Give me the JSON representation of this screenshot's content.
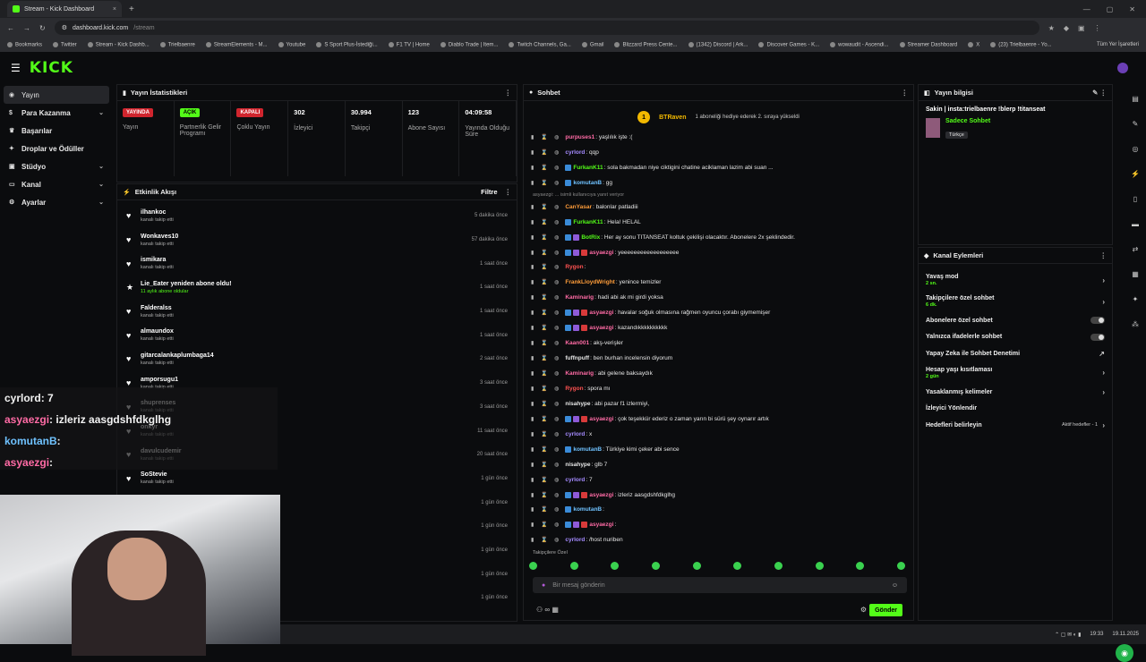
{
  "browser": {
    "tab_title": "Stream - Kick Dashboard",
    "url": "dashboard.kick.com",
    "url_path": "/stream",
    "new_tab": "+",
    "bookmarks": [
      "Bookmarks",
      "Twitter",
      "Stream - Kick Dashb...",
      "Trielbaenre",
      "StreamElements - M...",
      "Youtube",
      "S Sport Plus-İstediği...",
      "F1 TV | Home",
      "Diablo Trade | Item...",
      "Twitch Channels, Ga...",
      "Gmail",
      "Blizzard Press Cente...",
      "(1342) Discord | Ark...",
      "Discover Games - K...",
      "wowaudit - Ascendi...",
      "Streamer Dashboard",
      "X",
      "(23) Trielbaenre - Yo..."
    ],
    "all_bookmarks": "Tüm Yer İşaretleri"
  },
  "logo": "KICK",
  "sidebar": {
    "items": [
      {
        "label": "Yayın",
        "icon": "broadcast-icon",
        "chev": ""
      },
      {
        "label": "Para Kazanma",
        "icon": "money-icon",
        "chev": "⌄"
      },
      {
        "label": "Başarılar",
        "icon": "trophy-icon",
        "chev": ""
      },
      {
        "label": "Droplar ve Ödüller",
        "icon": "gift-icon",
        "chev": ""
      },
      {
        "label": "Stüdyo",
        "icon": "studio-icon",
        "chev": "⌄"
      },
      {
        "label": "Kanal",
        "icon": "channel-icon",
        "chev": "⌄"
      },
      {
        "label": "Ayarlar",
        "icon": "gear-icon",
        "chev": "⌄"
      }
    ]
  },
  "stats": {
    "title": "Yayın İstatistikleri",
    "items": [
      {
        "badge": "YAYINDA",
        "badge_color": "red",
        "label": "Yayın"
      },
      {
        "badge": "AÇIK",
        "badge_color": "green",
        "label": "Partnerlik Gelir Programı"
      },
      {
        "badge": "KAPALI",
        "badge_color": "red",
        "label": "Çoklu Yayın"
      },
      {
        "value": "302",
        "label": "İzleyici"
      },
      {
        "value": "30.994",
        "label": "Takipçi"
      },
      {
        "value": "123",
        "label": "Abone Sayısı"
      },
      {
        "value": "04:09:58",
        "label": "Yayında Olduğu Süre"
      }
    ]
  },
  "activity": {
    "title": "Etkinlik Akışı",
    "filter": "Filtre",
    "items": [
      {
        "name": "ilhankoc",
        "sub": "kanalı takip etti",
        "time": "5 dakika önce"
      },
      {
        "name": "Wonkaves10",
        "sub": "kanalı takip etti",
        "time": "57 dakika önce"
      },
      {
        "name": "ismikara",
        "sub": "kanalı takip etti",
        "time": "1 saat önce"
      },
      {
        "name": "Lie_Eater yeniden abone oldu!",
        "sub": "11 aylık abone oldular",
        "time": "1 saat önce",
        "sub_green": true
      },
      {
        "name": "Falderalss",
        "sub": "kanalı takip etti",
        "time": "1 saat önce"
      },
      {
        "name": "almaundox",
        "sub": "kanalı takip etti",
        "time": "1 saat önce"
      },
      {
        "name": "gitarcalankaplumbaga14",
        "sub": "kanalı takip etti",
        "time": "2 saat önce"
      },
      {
        "name": "amporsugu1",
        "sub": "kanalı takip etti",
        "time": "3 saat önce"
      },
      {
        "name": "shuprenses",
        "sub": "kanalı takip etti",
        "time": "3 saat önce"
      },
      {
        "name": "onkyr",
        "sub": "kanalı takip etti",
        "time": "11 saat önce"
      },
      {
        "name": "davulcudemir",
        "sub": "kanalı takip etti",
        "time": "20 saat önce"
      },
      {
        "name": "SoStevie",
        "sub": "kanalı takip etti",
        "time": "1 gün önce"
      },
      {
        "name": "",
        "sub": "",
        "time": "1 gün önce"
      },
      {
        "name": "",
        "sub": "",
        "time": "1 gün önce"
      },
      {
        "name": "",
        "sub": "",
        "time": "1 gün önce"
      },
      {
        "name": "",
        "sub": "",
        "time": "1 gün önce"
      },
      {
        "name": "",
        "sub": "",
        "time": "1 gün önce"
      }
    ]
  },
  "chat": {
    "title": "Sohbet",
    "top_user": "BTRaven",
    "top_user_level": "1",
    "top_text": "1 aboneliği hediye ederek 2. sıraya yükseldi",
    "system_note": "asyaezgi: ... isimli kullanıcıya yanıt veriyor",
    "messages": [
      {
        "user": "purpuses1",
        "text": ": yaşlılık işte :(",
        "color": "#ff6ba5",
        "badges": 0
      },
      {
        "user": "cyrlord",
        "text": ": qqp",
        "color": "#a58bff",
        "badges": 0
      },
      {
        "user": "FurkanK11",
        "text": ": sola bakmadan niye ciktigini chatine aciklaman lazim abi suan ...",
        "color": "#53fc18",
        "badges": 1
      },
      {
        "user": "komutanB",
        "text": ": gg",
        "color": "#6fc2ff",
        "badges": 1
      },
      {
        "user": "CanYasar",
        "text": ": balonlar patladiii",
        "color": "#ff9d3a",
        "badges": 0
      },
      {
        "user": "FurkanK11",
        "text": ": Hela! HELAL",
        "color": "#53fc18",
        "badges": 1
      },
      {
        "user": "BotRix",
        "text": ": Her ay sonu TITANSEAT koltuk çekilişi olacaktır. Abonelere 2x şeklindedir.",
        "color": "#53fc18",
        "badges": 2
      },
      {
        "user": "asyaezgi",
        "text": ": yeeeeeeeeeeeeeeeeee",
        "color": "#ff6ba5",
        "badges": 3
      },
      {
        "user": "Rygon",
        "text": ":",
        "color": "#ff5252",
        "badges": 0
      },
      {
        "user": "FrankLloydWright",
        "text": ": yenince temizler",
        "color": "#ff9d3a",
        "badges": 0
      },
      {
        "user": "Kaminarig",
        "text": ": hadi abi ak mi girdi yoksa",
        "color": "#ff6ba5",
        "badges": 0
      },
      {
        "user": "asyaezgi",
        "text": ": havalar soğuk olmasına rağmen oyuncu çorabı giymemişer",
        "color": "#ff6ba5",
        "badges": 3
      },
      {
        "user": "asyaezgi",
        "text": ": kazandıkkkkkkkkkk",
        "color": "#ff6ba5",
        "badges": 3
      },
      {
        "user": "Kaan001",
        "text": ": akş-verişler",
        "color": "#ff6ba5",
        "badges": 0
      },
      {
        "user": "fuffnpuff",
        "text": ": ben burhan incelensin diyorum",
        "color": "#e6e6e6",
        "badges": 0
      },
      {
        "user": "Kaminarig",
        "text": ": abi gelene baksaydık",
        "color": "#ff6ba5",
        "badges": 0
      },
      {
        "user": "Rygon",
        "text": ": spora mı",
        "color": "#ff5252",
        "badges": 0
      },
      {
        "user": "nisahype",
        "text": ": abi pazar f1 izlermiyi,",
        "color": "#e6e6e6",
        "badges": 0
      },
      {
        "user": "asyaezgi",
        "text": ": çok teşekkür ederiz o zaman yarın bi sürü şey oynarır artık",
        "color": "#ff6ba5",
        "badges": 3
      },
      {
        "user": "cyrlord",
        "text": ": x",
        "color": "#a58bff",
        "badges": 0
      },
      {
        "user": "komutanB",
        "text": ": Türkiye kimi çeker abi sence",
        "color": "#6fc2ff",
        "badges": 1
      },
      {
        "user": "nisahype",
        "text": ": glb 7",
        "color": "#e6e6e6",
        "badges": 0
      },
      {
        "user": "cyrlord",
        "text": ": 7",
        "color": "#a58bff",
        "badges": 0
      },
      {
        "user": "asyaezgi",
        "text": ": izleriz aasgdshfdkglhg",
        "color": "#ff6ba5",
        "badges": 3
      },
      {
        "user": "komutanB",
        "text": ":",
        "color": "#6fc2ff",
        "badges": 1
      },
      {
        "user": "asyaezgi",
        "text": ":",
        "color": "#ff6ba5",
        "badges": 3
      },
      {
        "user": "cyrlord",
        "text": ": /host nuriben",
        "color": "#a58bff",
        "badges": 0
      }
    ],
    "followers_only": "Takipçilere Özel",
    "placeholder": "Bir mesaj gönderin",
    "send": "Gönder"
  },
  "streaminfo": {
    "title": "Yayın bilgisi",
    "stream_title": "Sakin | insta:trielbaenre !blerp !titanseat",
    "category": "Sadece Sohbet",
    "language": "Türkçe"
  },
  "channel_actions": {
    "title": "Kanal Eylemleri",
    "items": [
      {
        "label": "Yavaş mod",
        "sub": "2 sn.",
        "kind": "chev"
      },
      {
        "label": "Takipçilere özel sohbet",
        "sub": "6 dk.",
        "kind": "chev"
      },
      {
        "label": "Abonelere özel sohbet",
        "sub": "",
        "kind": "toggle"
      },
      {
        "label": "Yalnızca ifadelerle sohbet",
        "sub": "",
        "kind": "toggle"
      },
      {
        "label": "Yapay Zeka ile Sohbet Denetimi",
        "sub": "",
        "kind": "ext"
      },
      {
        "label": "Hesap yaşı kısıtlaması",
        "sub": "2 gün",
        "kind": "chev"
      },
      {
        "label": "Yasaklanmış kelimeler",
        "sub": "",
        "kind": "chev"
      },
      {
        "label": "İzleyici Yönlendir",
        "sub": "",
        "kind": "none"
      },
      {
        "label": "Hedefleri belirleyin",
        "sub": "",
        "kind": "goal",
        "extra": "Aktif hedefler - 1"
      }
    ]
  },
  "overlay": [
    {
      "user": "cyrlord",
      "text": ": 7"
    },
    {
      "user": "asyaezgi",
      "text": ": izleriz aasgdshfdkglhg"
    },
    {
      "user": "komutanB",
      "text": ":"
    },
    {
      "user": "asyaezgi",
      "text": ":"
    }
  ],
  "taskbar": {
    "time": "19:33",
    "date": "19.11.2025"
  }
}
